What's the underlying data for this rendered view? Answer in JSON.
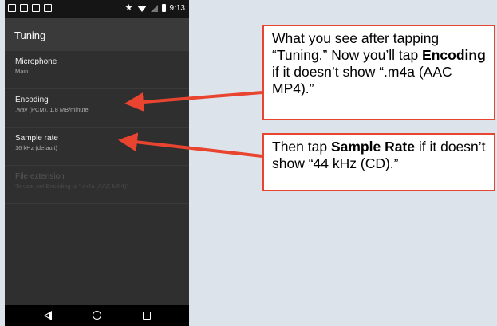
{
  "status": {
    "time": "9:13"
  },
  "toolbar": {
    "title": "Tuning"
  },
  "prefs": [
    {
      "title": "Microphone",
      "subtitle": "Main"
    },
    {
      "title": "Encoding",
      "subtitle": ".wav (PCM), 1.8 MB/minute"
    },
    {
      "title": "Sample rate",
      "subtitle": "16 kHz (default)"
    },
    {
      "title": "File extension",
      "subtitle": "To use, set Encoding to \".m4a (AAC MP4)\""
    }
  ],
  "callouts": {
    "first": {
      "pre": "What you see after tapping “Tuning.” Now you’ll tap ",
      "bold": "Encoding",
      "post": " if it doesn’t show “.m4a (AAC MP4).”"
    },
    "second": {
      "pre": "Then tap ",
      "bold": "Sample Rate",
      "post": " if it doesn’t show “44 kHz (CD).”"
    }
  },
  "colors": {
    "accent": "#e8442f",
    "background": "#dde3ea",
    "phone_bg": "#2f2f2f"
  }
}
